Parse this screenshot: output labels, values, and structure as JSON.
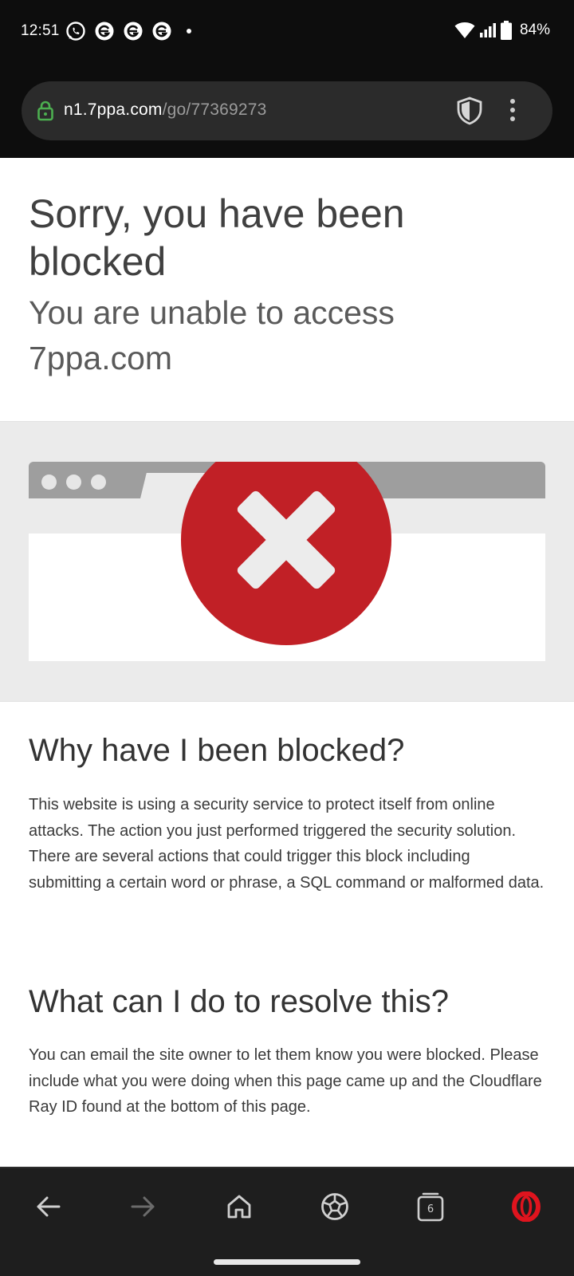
{
  "status_bar": {
    "time": "12:51",
    "battery": "84%",
    "notification_icons": [
      "whatsapp-icon",
      "app-e-icon",
      "app-e-icon",
      "app-e-icon"
    ]
  },
  "browser": {
    "url_host": "n1.7ppa.com",
    "url_path": "/go/77369273",
    "tab_count": "6"
  },
  "page": {
    "title": "Sorry, you have been blocked",
    "subtitle": "You are unable to access 7ppa.com",
    "why_heading": "Why have I been blocked?",
    "why_text": "This website is using a security service to protect itself from online attacks. The action you just performed triggered the security solution. There are several actions that could trigger this block including submitting a certain word or phrase, a SQL command or malformed data.",
    "resolve_heading": "What can I do to resolve this?",
    "resolve_text": "You can email the site owner to let them know you were blocked. Please include what you were doing when this page came up and the Cloudflare Ray ID found at the bottom of this page."
  },
  "colors": {
    "error_red": "#c12026",
    "opera_red": "#e0141e",
    "lock_green": "#4caf50"
  }
}
